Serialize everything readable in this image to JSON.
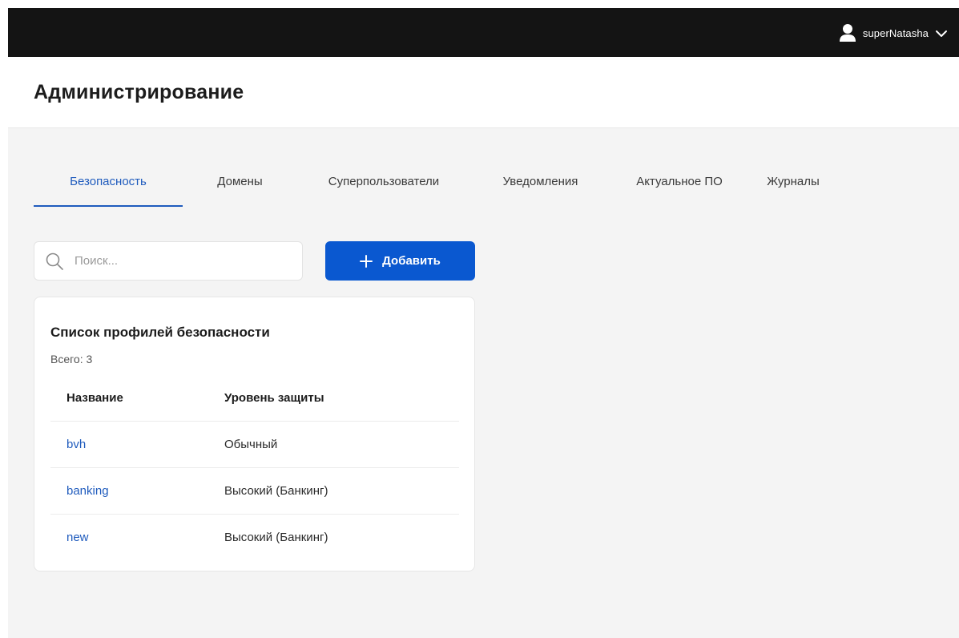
{
  "user": {
    "name": "superNatasha"
  },
  "header": {
    "title": "Администрирование"
  },
  "tabs": [
    {
      "label": "Безопасность",
      "active": true
    },
    {
      "label": "Домены"
    },
    {
      "label": "Суперпользователи"
    },
    {
      "label": "Уведомления"
    },
    {
      "label": "Актуальное ПО"
    },
    {
      "label": "Журналы"
    }
  ],
  "search": {
    "placeholder": "Поиск...",
    "value": ""
  },
  "add_button": {
    "label": "Добавить"
  },
  "card": {
    "title": "Список профилей безопасности",
    "total": "Всего: 3",
    "columns": [
      "Название",
      "Уровень защиты"
    ],
    "rows": [
      {
        "name": "bvh",
        "level": "Обычный"
      },
      {
        "name": "banking",
        "level": "Высокий (Банкинг)"
      },
      {
        "name": "new",
        "level": "Высокий (Банкинг)"
      }
    ]
  },
  "colors": {
    "topbar": "#141414",
    "accent": "#1f5bbd",
    "button": "#0a58d0",
    "background": "#f4f4f4"
  },
  "icons": {
    "user": "user-icon",
    "menu": "chevron-down-icon",
    "search": "search-icon",
    "add": "plus-icon"
  }
}
